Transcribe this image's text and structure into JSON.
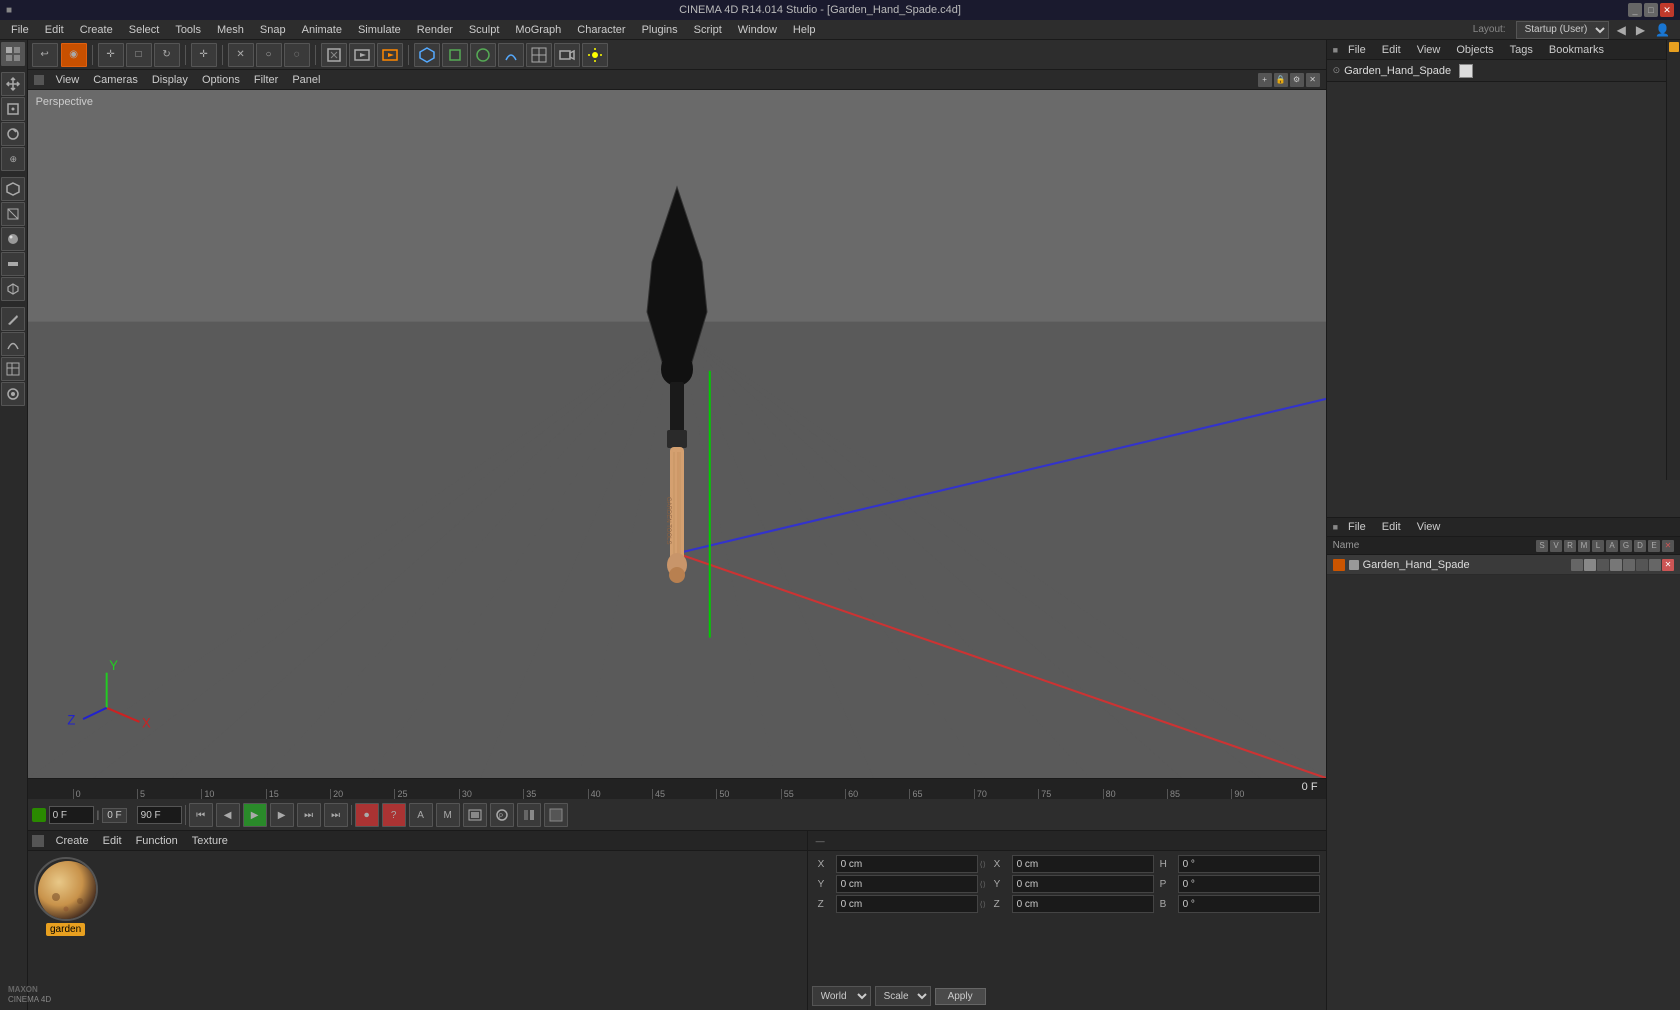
{
  "app": {
    "title": "CINEMA 4D R14.014 Studio - [Garden_Hand_Spade.c4d]",
    "layout_label": "Layout:",
    "layout_value": "Startup (User)"
  },
  "titlebar": {
    "title": "CINEMA 4D R14.014 Studio - [Garden_Hand_Spade.c4d]",
    "min": "_",
    "max": "□",
    "close": "✕"
  },
  "menubar": {
    "items": [
      "File",
      "Edit",
      "Create",
      "Select",
      "Tools",
      "Mesh",
      "Snap",
      "Animate",
      "Simulate",
      "Render",
      "Sculpt",
      "MoGraph",
      "Character",
      "Plugins",
      "Script",
      "Window",
      "Help"
    ]
  },
  "top_toolbar": {
    "buttons": [
      "↩",
      "◉",
      "✛",
      "□",
      "↻",
      "✛",
      "✕",
      "○",
      "◌",
      "▣",
      "▷",
      "⬡",
      "◎",
      "⬡",
      "▦",
      "☾",
      "👁"
    ]
  },
  "viewport": {
    "label": "Perspective",
    "menu_items": [
      "View",
      "Cameras",
      "Display",
      "Options",
      "Filter",
      "Panel"
    ]
  },
  "timeline": {
    "ruler_marks": [
      "0",
      "5",
      "10",
      "15",
      "20",
      "25",
      "30",
      "35",
      "40",
      "45",
      "50",
      "55",
      "60",
      "65",
      "70",
      "75",
      "80",
      "85",
      "90"
    ],
    "frame_indicator": "0 F",
    "frame_start": "0 F",
    "frame_end": "90 F",
    "frame_current": "0 F"
  },
  "material_editor": {
    "menu_items": [
      "Create",
      "Edit",
      "Function",
      "Texture"
    ],
    "material_name": "garden",
    "thumbnail_label": "garden"
  },
  "coords": {
    "x_label": "X",
    "y_label": "Y",
    "z_label": "Z",
    "x_val": "0 cm",
    "y_val": "0 cm",
    "z_val": "0 cm",
    "x2_val": "0 cm",
    "y2_val": "0 cm",
    "z2_val": "0 cm",
    "h_label": "H",
    "p_label": "P",
    "b_label": "B",
    "h_val": "0 °",
    "p_val": "0 °",
    "b_val": "0 °",
    "world_label": "World",
    "scale_label": "Scale",
    "apply_label": "Apply"
  },
  "right_panel": {
    "menu_items": [
      "File",
      "Edit",
      "View",
      "Objects",
      "Tags",
      "Bookmarks"
    ],
    "obj_name": "Garden_Hand_Spade",
    "layout_label": "Layout:",
    "layout_value": "Startup (User)"
  },
  "obj_manager": {
    "menu_items": [
      "File",
      "Edit",
      "View"
    ],
    "col_headers": [
      "Name",
      "S",
      "V",
      "R",
      "M",
      "L",
      "A",
      "G",
      "D",
      "E",
      "X"
    ],
    "obj_name": "Garden_Hand_Spade"
  },
  "icons": {
    "undo": "↩",
    "live_select": "◉",
    "move": "✛",
    "scale": "□",
    "rotate": "↻",
    "plus": "+",
    "play": "▶",
    "rewind": "⏮",
    "stop": "■",
    "record": "⏺"
  }
}
